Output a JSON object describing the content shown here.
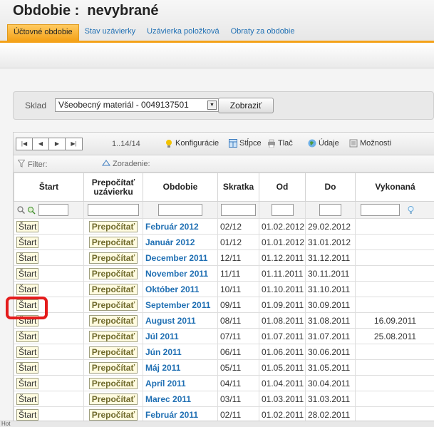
{
  "header": {
    "title": "Obdobie :  nevybrané",
    "tabs": [
      {
        "label": "Účtovné obdobie",
        "active": true
      },
      {
        "label": "Stav uzávierky",
        "active": false
      },
      {
        "label": "Uzávierka položková",
        "active": false
      },
      {
        "label": "Obraty za obdobie",
        "active": false
      }
    ]
  },
  "filter": {
    "sklad_label": "Sklad",
    "sklad_value": "Všeobecný materiál - 0049137501",
    "show_button": "Zobraziť"
  },
  "toolbar": {
    "pager_first": "|◀",
    "pager_prev": "◀",
    "pager_next": "▶",
    "pager_last": "▶|",
    "range": "1..14/14",
    "config": "Konfigurácie",
    "columns": "Stĺpce",
    "print": "Tlač",
    "data": "Údaje",
    "options": "Možnosti"
  },
  "filterbar": {
    "filter": "Filter:",
    "sort": "Zoradenie:"
  },
  "columns": [
    "Štart",
    "Prepočítať uzávierku",
    "Obdobie",
    "Skratka",
    "Od",
    "Do",
    "Vykonaná"
  ],
  "row_buttons": {
    "start": "Štart",
    "recalc": "Prepočítať"
  },
  "rows": [
    {
      "obdobie": "Február 2012",
      "skratka": "02/12",
      "od": "01.02.2012",
      "do": "29.02.2012",
      "vykonana": ""
    },
    {
      "obdobie": "Január 2012",
      "skratka": "01/12",
      "od": "01.01.2012",
      "do": "31.01.2012",
      "vykonana": ""
    },
    {
      "obdobie": "December 2011",
      "skratka": "12/11",
      "od": "01.12.2011",
      "do": "31.12.2011",
      "vykonana": ""
    },
    {
      "obdobie": "November 2011",
      "skratka": "11/11",
      "od": "01.11.2011",
      "do": "30.11.2011",
      "vykonana": ""
    },
    {
      "obdobie": "Október 2011",
      "skratka": "10/11",
      "od": "01.10.2011",
      "do": "31.10.2011",
      "vykonana": ""
    },
    {
      "obdobie": "September 2011",
      "skratka": "09/11",
      "od": "01.09.2011",
      "do": "30.09.2011",
      "vykonana": ""
    },
    {
      "obdobie": "August 2011",
      "skratka": "08/11",
      "od": "01.08.2011",
      "do": "31.08.2011",
      "vykonana": "16.09.2011"
    },
    {
      "obdobie": "Júl 2011",
      "skratka": "07/11",
      "od": "01.07.2011",
      "do": "31.07.2011",
      "vykonana": "25.08.2011"
    },
    {
      "obdobie": "Jún 2011",
      "skratka": "06/11",
      "od": "01.06.2011",
      "do": "30.06.2011",
      "vykonana": ""
    },
    {
      "obdobie": "Máj 2011",
      "skratka": "05/11",
      "od": "01.05.2011",
      "do": "31.05.2011",
      "vykonana": ""
    },
    {
      "obdobie": "Apríl 2011",
      "skratka": "04/11",
      "od": "01.04.2011",
      "do": "30.04.2011",
      "vykonana": ""
    },
    {
      "obdobie": "Marec 2011",
      "skratka": "03/11",
      "od": "01.03.2011",
      "do": "31.03.2011",
      "vykonana": ""
    },
    {
      "obdobie": "Február 2011",
      "skratka": "02/11",
      "od": "01.02.2011",
      "do": "28.02.2011",
      "vykonana": ""
    }
  ],
  "status": "Hot",
  "colors": {
    "accent": "#f4a219",
    "link": "#1f6fb3",
    "highlight": "#e41c1c"
  }
}
